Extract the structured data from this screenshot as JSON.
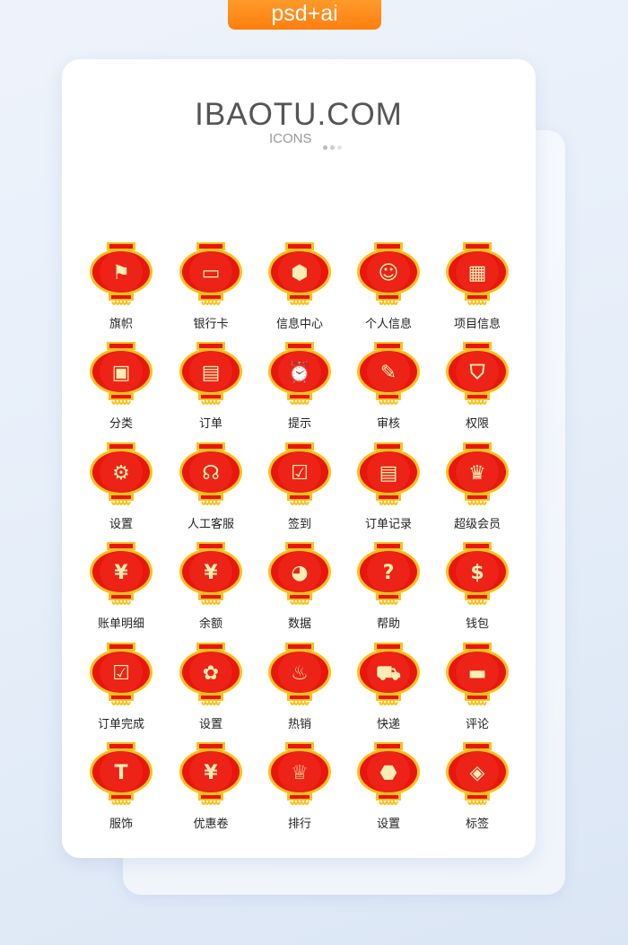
{
  "badge": "psd+ai",
  "header": {
    "brand": "IBAOTU.COM",
    "subtitle": "ICONS"
  },
  "colors": {
    "lantern_red": "#e8160c",
    "lantern_gold": "#f7c21b",
    "glyph": "#fbeeb4",
    "badge": "#ff8a1a"
  },
  "icons": [
    {
      "label": "旗帜",
      "icon": "flag-icon"
    },
    {
      "label": "银行卡",
      "icon": "bank-card-icon"
    },
    {
      "label": "信息中心",
      "icon": "message-icon"
    },
    {
      "label": "个人信息",
      "icon": "id-card-icon"
    },
    {
      "label": "项目信息",
      "icon": "building-icon"
    },
    {
      "label": "分类",
      "icon": "category-icon"
    },
    {
      "label": "订单",
      "icon": "order-icon"
    },
    {
      "label": "提示",
      "icon": "alarm-icon"
    },
    {
      "label": "审核",
      "icon": "review-icon"
    },
    {
      "label": "权限",
      "icon": "shield-icon"
    },
    {
      "label": "设置",
      "icon": "settings-icon"
    },
    {
      "label": "人工客服",
      "icon": "headset-icon"
    },
    {
      "label": "签到",
      "icon": "calendar-check-icon"
    },
    {
      "label": "订单记录",
      "icon": "order-record-icon"
    },
    {
      "label": "超级会员",
      "icon": "crown-icon"
    },
    {
      "label": "账单明细",
      "icon": "bill-icon"
    },
    {
      "label": "余额",
      "icon": "balance-icon"
    },
    {
      "label": "数据",
      "icon": "pie-chart-icon"
    },
    {
      "label": "帮助",
      "icon": "help-icon"
    },
    {
      "label": "钱包",
      "icon": "money-bag-icon"
    },
    {
      "label": "订单完成",
      "icon": "checkbox-icon"
    },
    {
      "label": "设置",
      "icon": "gear-icon"
    },
    {
      "label": "热销",
      "icon": "fire-icon"
    },
    {
      "label": "快递",
      "icon": "truck-icon"
    },
    {
      "label": "评论",
      "icon": "comment-icon"
    },
    {
      "label": "服饰",
      "icon": "tshirt-icon"
    },
    {
      "label": "优惠卷",
      "icon": "coupon-icon"
    },
    {
      "label": "排行",
      "icon": "trophy-icon"
    },
    {
      "label": "设置",
      "icon": "nut-icon"
    },
    {
      "label": "标签",
      "icon": "tag-icon"
    }
  ]
}
